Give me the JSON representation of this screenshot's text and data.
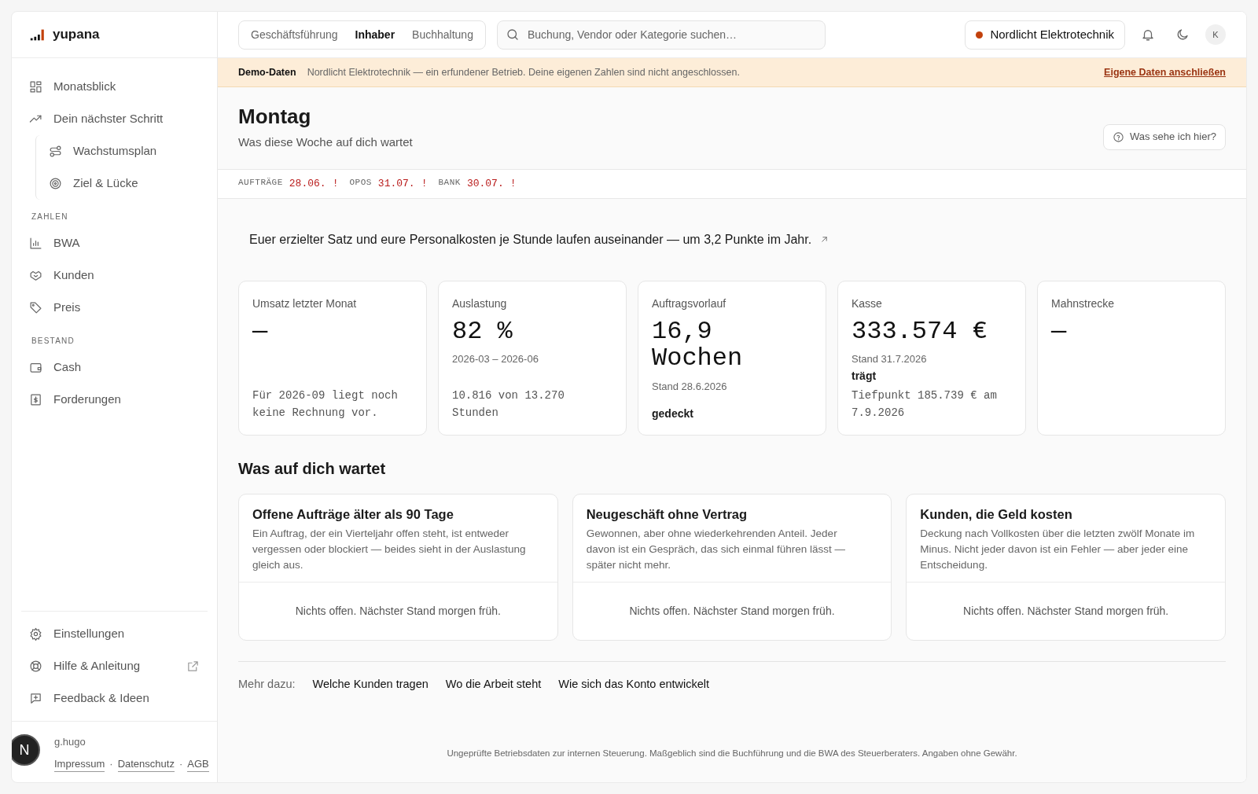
{
  "brand": "yupana",
  "sidebar": {
    "items": [
      {
        "label": "Monatsblick"
      },
      {
        "label": "Dein nächster Schritt",
        "children": [
          {
            "label": "Wachstumsplan"
          },
          {
            "label": "Ziel & Lücke"
          }
        ]
      }
    ],
    "sections": [
      {
        "heading": "ZAHLEN",
        "items": [
          {
            "label": "BWA"
          },
          {
            "label": "Kunden"
          },
          {
            "label": "Preis"
          }
        ]
      },
      {
        "heading": "BESTAND",
        "items": [
          {
            "label": "Cash"
          },
          {
            "label": "Forderungen"
          }
        ]
      }
    ],
    "bottom_items": [
      {
        "label": "Einstellungen",
        "external": false
      },
      {
        "label": "Hilfe & Anleitung",
        "external": true
      },
      {
        "label": "Feedback & Ideen",
        "external": false
      }
    ],
    "credit": "g.hugo",
    "legal_links": [
      "Impressum",
      "Datenschutz",
      "AGB"
    ],
    "legal_separators": [
      "·",
      "·"
    ],
    "dev_badge": "N"
  },
  "role_tabs": [
    {
      "label": "Geschäftsführung",
      "selected": false
    },
    {
      "label": "Inhaber",
      "selected": true
    },
    {
      "label": "Buchhaltung",
      "selected": false
    }
  ],
  "search": {
    "placeholder": "Buchung, Vendor oder Kategorie suchen…"
  },
  "company": "Nordlicht Elektrotechnik",
  "avatar": "K",
  "banner": {
    "label": "Demo-Daten",
    "text": "Nordlicht Elektrotechnik — ein erfundener Betrieb. Deine eigenen Zahlen sind nicht angeschlossen.",
    "link": "Eigene Daten anschließen"
  },
  "page": {
    "title": "Montag",
    "subtitle": "Was diese Woche auf dich wartet",
    "help_button": "Was sehe ich hier?"
  },
  "deadlines": [
    {
      "label": "AUFTRÄGE",
      "date": "28.06.",
      "flag": "!"
    },
    {
      "label": "OPOS",
      "date": "31.07.",
      "flag": "!"
    },
    {
      "label": "BANK",
      "date": "30.07.",
      "flag": "!"
    }
  ],
  "insight": "Euer erzielter Satz und eure Personalkosten je Stunde laufen auseinander — um 3,2 Punkte im Jahr.",
  "kpis": [
    {
      "label": "Umsatz letzter Monat",
      "value": "—",
      "note": "Für 2026-09 liegt noch keine Rechnung vor."
    },
    {
      "label": "Auslastung",
      "value": "82 %",
      "sub": "2026-03 – 2026-06",
      "note": "10.816 von 13.270 Stunden"
    },
    {
      "label": "Auftragsvorlauf",
      "value": "16,9 Wochen",
      "sub": "Stand 28.6.2026",
      "status": "gedeckt"
    },
    {
      "label": "Kasse",
      "value": "333.574 €",
      "sub": "Stand 31.7.2026",
      "status": "trägt",
      "note": "Tiefpunkt 185.739 € am 7.9.2026"
    },
    {
      "label": "Mahnstrecke",
      "value": "—"
    }
  ],
  "tasks_title": "Was auf dich wartet",
  "tasks": [
    {
      "title": "Offene Aufträge älter als 90 Tage",
      "text": "Ein Auftrag, der ein Vierteljahr offen steht, ist entweder vergessen oder blockiert — beides sieht in der Auslastung gleich aus.",
      "empty": "Nichts offen. Nächster Stand morgen früh."
    },
    {
      "title": "Neugeschäft ohne Vertrag",
      "text": "Gewonnen, aber ohne wiederkehrenden Anteil. Jeder davon ist ein Gespräch, das sich einmal führen lässt — später nicht mehr.",
      "empty": "Nichts offen. Nächster Stand morgen früh."
    },
    {
      "title": "Kunden, die Geld kosten",
      "text": "Deckung nach Vollkosten über die letzten zwölf Monate im Minus. Nicht jeder davon ist ein Fehler — aber jeder eine Entscheidung.",
      "empty": "Nichts offen. Nächster Stand morgen früh."
    }
  ],
  "more": {
    "label": "Mehr dazu:",
    "links": [
      "Welche Kunden tragen",
      "Wo die Arbeit steht",
      "Wie sich das Konto entwickelt"
    ]
  },
  "disclaimer": "Ungeprüfte Betriebsdaten zur internen Steuerung. Maßgeblich sind die Buchführung und die BWA des Steuerberaters. Angaben ohne Gewähr."
}
